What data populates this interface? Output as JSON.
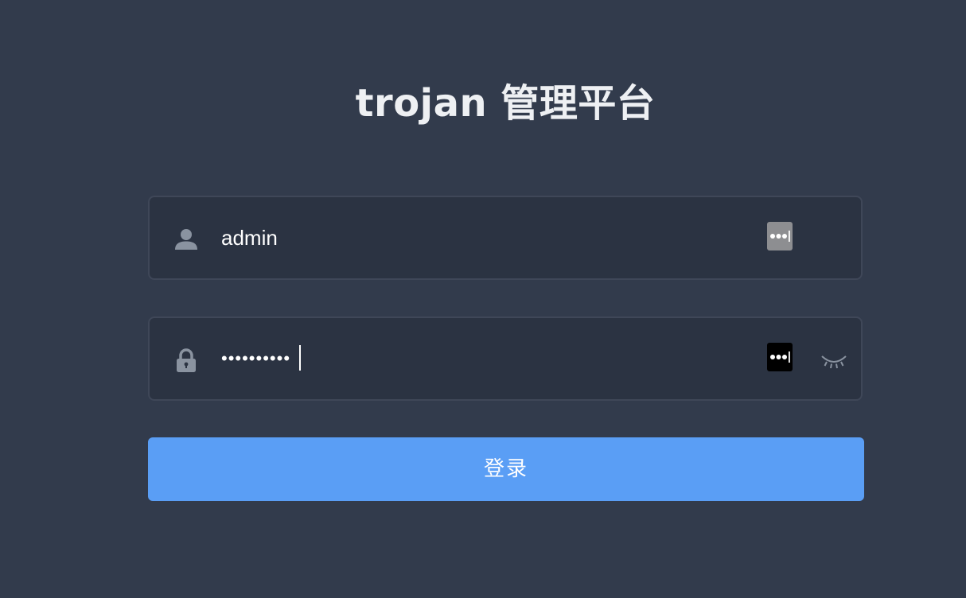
{
  "title": "trojan 管理平台",
  "username": {
    "value": "admin",
    "icon": "user-icon",
    "manager_icon": "password-manager-icon"
  },
  "password": {
    "value": "••••••••••",
    "icon": "lock-icon",
    "manager_icon": "password-manager-icon",
    "toggle_icon": "eye-closed-icon"
  },
  "login_button": {
    "label": "登录"
  },
  "colors": {
    "background": "#323b4c",
    "field_background": "#2b3342",
    "field_border": "#3f4758",
    "button": "#5a9ef5",
    "icon": "#8a93a0"
  }
}
